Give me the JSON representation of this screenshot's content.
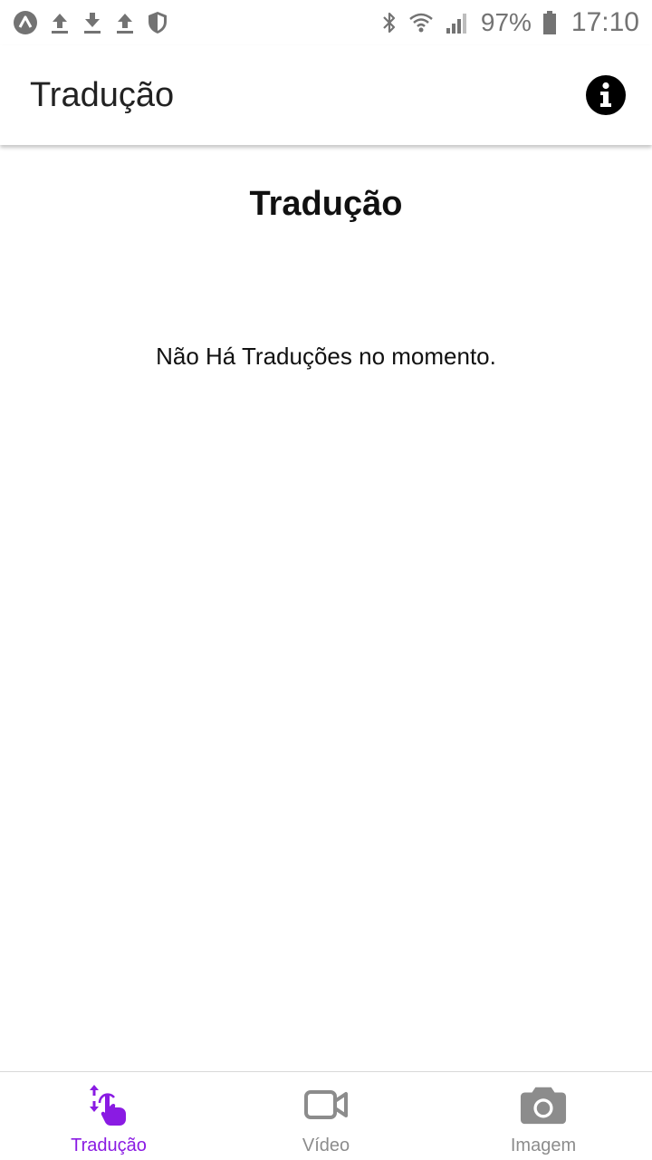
{
  "status_bar": {
    "battery_percent": "97%",
    "time": "17:10",
    "left_icons": [
      "app-logo-icon",
      "upload-icon",
      "download-icon",
      "upload-icon",
      "shield-icon"
    ],
    "right_icons": [
      "bluetooth-icon",
      "wifi-icon",
      "signal-icon",
      "battery-icon"
    ]
  },
  "app_bar": {
    "title": "Tradução",
    "action_icon": "info-icon"
  },
  "main": {
    "title": "Tradução",
    "empty_message": "Não Há Traduções no momento."
  },
  "bottom_nav": {
    "active_index": 0,
    "items": [
      {
        "label": "Tradução",
        "icon": "translate-touch-icon"
      },
      {
        "label": "Vídeo",
        "icon": "video-camera-icon"
      },
      {
        "label": "Imagem",
        "icon": "camera-icon"
      }
    ]
  },
  "colors": {
    "accent": "#8a1be3",
    "inactive": "#8c8c8c",
    "status_icons": "#737373"
  }
}
